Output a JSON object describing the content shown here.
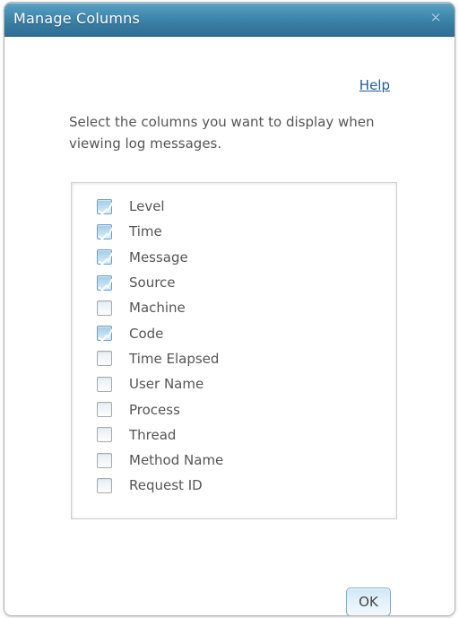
{
  "dialog": {
    "title": "Manage Columns",
    "close_icon": "close-icon",
    "close_glyph": "✕"
  },
  "help": {
    "label": "Help"
  },
  "instructions": {
    "text": "Select the columns you want to display when viewing log messages."
  },
  "columns": [
    {
      "label": "Level",
      "checked": true
    },
    {
      "label": "Time",
      "checked": true
    },
    {
      "label": "Message",
      "checked": true
    },
    {
      "label": "Source",
      "checked": true
    },
    {
      "label": "Machine",
      "checked": false
    },
    {
      "label": "Code",
      "checked": true
    },
    {
      "label": "Time Elapsed",
      "checked": false
    },
    {
      "label": "User Name",
      "checked": false
    },
    {
      "label": "Process",
      "checked": false
    },
    {
      "label": "Thread",
      "checked": false
    },
    {
      "label": "Method Name",
      "checked": false
    },
    {
      "label": "Request ID",
      "checked": false
    }
  ],
  "footer": {
    "ok_label": "OK"
  },
  "colors": {
    "titlebar_top": "#63a6c6",
    "titlebar_bottom": "#2f6f95",
    "link": "#1f5c99",
    "text": "#555555",
    "checkbox_checked_border": "#6f9fc0",
    "checkbox_unchecked_border": "#a9a9a9",
    "button_border": "#7aaed0"
  }
}
